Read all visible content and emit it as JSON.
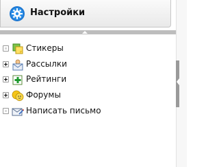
{
  "header": {
    "title": "Настройки",
    "icon": "settings-gear-icon"
  },
  "tree": {
    "items": [
      {
        "label": "Стикеры",
        "icon": "stickers-icon",
        "expandable": false
      },
      {
        "label": "Рассылки",
        "icon": "mailing-icon",
        "expandable": true
      },
      {
        "label": "Рейтинги",
        "icon": "ratings-icon",
        "expandable": true
      },
      {
        "label": "Форумы",
        "icon": "forums-icon",
        "expandable": true
      },
      {
        "label": "Написать письмо",
        "icon": "write-letter-icon",
        "expandable": false
      }
    ]
  }
}
